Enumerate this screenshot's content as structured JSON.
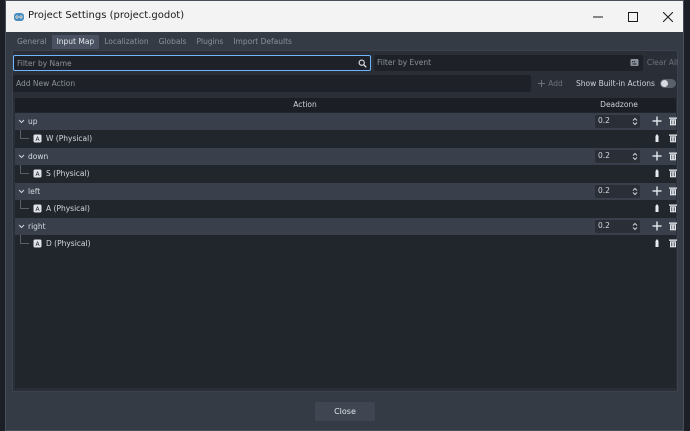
{
  "window": {
    "title": "Project Settings (project.godot)",
    "controls": {
      "minimize": "minimize-icon",
      "maximize": "maximize-icon",
      "close": "close-icon"
    }
  },
  "tabs": [
    {
      "label": "General",
      "active": false
    },
    {
      "label": "Input Map",
      "active": true
    },
    {
      "label": "Localization",
      "active": false
    },
    {
      "label": "Globals",
      "active": false
    },
    {
      "label": "Plugins",
      "active": false
    },
    {
      "label": "Import Defaults",
      "active": false
    }
  ],
  "filters": {
    "name_placeholder": "Filter by Name",
    "name_value": "",
    "event_placeholder": "Filter by Event",
    "clear_all_label": "Clear All"
  },
  "add_action": {
    "placeholder": "Add New Action",
    "button_label": "Add",
    "show_builtin_label": "Show Built-in Actions",
    "show_builtin_on": false
  },
  "table": {
    "col_action": "Action",
    "col_deadzone": "Deadzone",
    "actions": [
      {
        "name": "up",
        "deadzone": "0.2",
        "events": [
          {
            "label": "W (Physical)"
          }
        ]
      },
      {
        "name": "down",
        "deadzone": "0.2",
        "events": [
          {
            "label": "S (Physical)"
          }
        ]
      },
      {
        "name": "left",
        "deadzone": "0.2",
        "events": [
          {
            "label": "A (Physical)"
          }
        ]
      },
      {
        "name": "right",
        "deadzone": "0.2",
        "events": [
          {
            "label": "D (Physical)"
          }
        ]
      }
    ]
  },
  "footer": {
    "close_label": "Close"
  },
  "colors": {
    "accent": "#6db5ff",
    "panel": "#2a2f37",
    "action_row": "#3a404b"
  }
}
